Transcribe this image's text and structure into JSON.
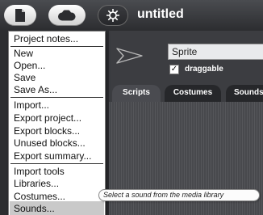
{
  "topbar": {
    "title": "untitled",
    "buttons": [
      {
        "name": "file-button",
        "icon": "page-icon"
      },
      {
        "name": "cloud-button",
        "icon": "cloud-icon"
      },
      {
        "name": "settings-button",
        "icon": "gear-icon"
      }
    ]
  },
  "sprite": {
    "name": "Sprite",
    "draggable_label": "draggable",
    "draggable_checked": true,
    "checkmark": "✓",
    "icon": "arrowhead-icon"
  },
  "tabs": [
    "Scripts",
    "Costumes",
    "Sounds"
  ],
  "menu": {
    "groups": [
      [
        "Project notes..."
      ],
      [
        "New",
        "Open...",
        "Save",
        "Save As..."
      ],
      [
        "Import...",
        "Export project...",
        "Export blocks...",
        "Unused blocks...",
        "Export summary..."
      ],
      [
        "Import tools",
        "Libraries...",
        "Costumes...",
        "Sounds..."
      ]
    ],
    "highlighted_item": "Sounds..."
  },
  "tooltip": "Select a sound from the media library",
  "colors": {
    "topbar": "#2c2d30",
    "ide_background": "#2c2d30",
    "menu_background": "#ffffff",
    "menu_highlight": "#c9c9c9"
  }
}
